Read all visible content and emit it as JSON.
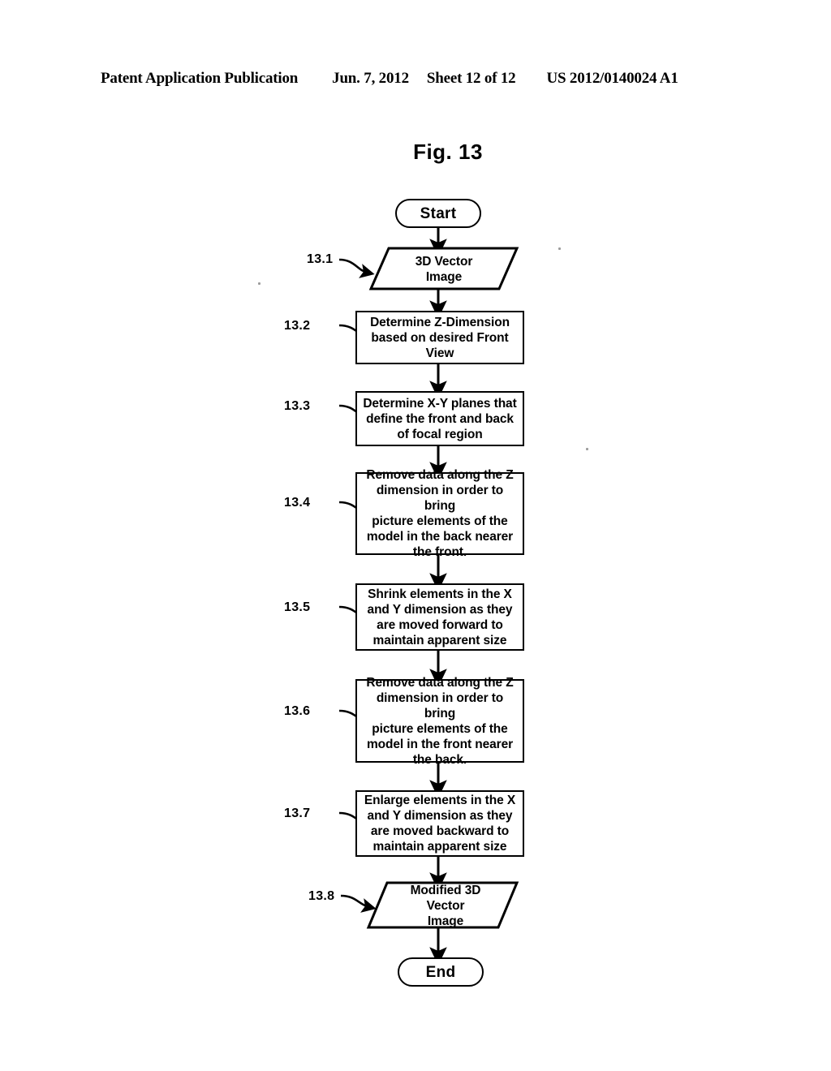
{
  "header": {
    "publication": "Patent Application Publication",
    "date": "Jun. 7, 2012",
    "sheet": "Sheet 12 of 12",
    "patent_number": "US 2012/0140024 A1"
  },
  "figure": {
    "title": "Fig. 13"
  },
  "flowchart": {
    "start_label": "Start",
    "end_label": "End",
    "nodes": [
      {
        "ref": "13.1",
        "shape": "parallelogram",
        "text": "3D Vector\nImage"
      },
      {
        "ref": "13.2",
        "shape": "rectangle",
        "text": "Determine Z-Dimension\nbased on desired Front\nView"
      },
      {
        "ref": "13.3",
        "shape": "rectangle",
        "text": "Determine X-Y planes that\ndefine the front and back\nof focal region"
      },
      {
        "ref": "13.4",
        "shape": "rectangle",
        "text": "Remove data along the Z\ndimension in order to bring\npicture elements of the\nmodel in the back nearer\nthe front."
      },
      {
        "ref": "13.5",
        "shape": "rectangle",
        "text": "Shrink elements in the X\nand Y dimension as they\nare moved forward to\nmaintain apparent size"
      },
      {
        "ref": "13.6",
        "shape": "rectangle",
        "text": "Remove data along the Z\ndimension in order to bring\npicture elements of the\nmodel in the front nearer\nthe back."
      },
      {
        "ref": "13.7",
        "shape": "rectangle",
        "text": "Enlarge elements in the X\nand Y dimension as they\nare moved backward to\nmaintain apparent size"
      },
      {
        "ref": "13.8",
        "shape": "parallelogram",
        "text": "Modified 3D\nVector\nImage"
      }
    ]
  },
  "colors": {
    "ink": "#000000",
    "paper": "#ffffff"
  }
}
